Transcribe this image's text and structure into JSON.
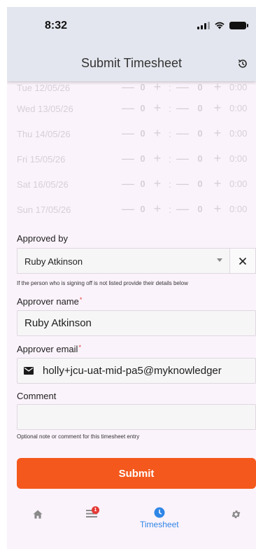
{
  "status_bar": {
    "time": "8:32"
  },
  "app_bar": {
    "title": "Submit Timesheet"
  },
  "days": [
    {
      "label": "Tue  12/05/26",
      "hours": "0",
      "minutes": "0",
      "total": "0:00"
    },
    {
      "label": "Wed 13/05/26",
      "hours": "0",
      "minutes": "0",
      "total": "0:00"
    },
    {
      "label": "Thu  14/05/26",
      "hours": "0",
      "minutes": "0",
      "total": "0:00"
    },
    {
      "label": "Fri   15/05/26",
      "hours": "0",
      "minutes": "0",
      "total": "0:00"
    },
    {
      "label": "Sat  16/05/26",
      "hours": "0",
      "minutes": "0",
      "total": "0:00"
    },
    {
      "label": "Sun  17/05/26",
      "hours": "0",
      "minutes": "0",
      "total": "0:00"
    }
  ],
  "controls": {
    "minus": "—",
    "plus": "+",
    "colon": ":"
  },
  "form": {
    "approved_by_label": "Approved by",
    "approved_by_value": "Ruby Atkinson",
    "approved_by_helper": "If the person who is signing off is not listed provide their details below",
    "approver_name_label": "Approver name",
    "approver_name_value": "Ruby Atkinson",
    "approver_email_label": "Approver email",
    "approver_email_value": "holly+jcu-uat-mid-pa5@myknowledger",
    "required_marker": "*",
    "comment_label": "Comment",
    "comment_value": "",
    "comment_helper": "Optional note or comment for this timesheet entry",
    "submit_label": "Submit"
  },
  "bottom_nav": {
    "items": [
      {
        "name": "home",
        "label": ""
      },
      {
        "name": "list",
        "label": "",
        "badge": "1"
      },
      {
        "name": "timesheet",
        "label": "Timesheet"
      },
      {
        "name": "settings",
        "label": ""
      }
    ]
  },
  "colors": {
    "accent": "#f4581c",
    "active_nav": "#2f86e6",
    "badge": "#e53935",
    "background": "#fbf3fb",
    "app_bar": "#e3e6ee"
  }
}
